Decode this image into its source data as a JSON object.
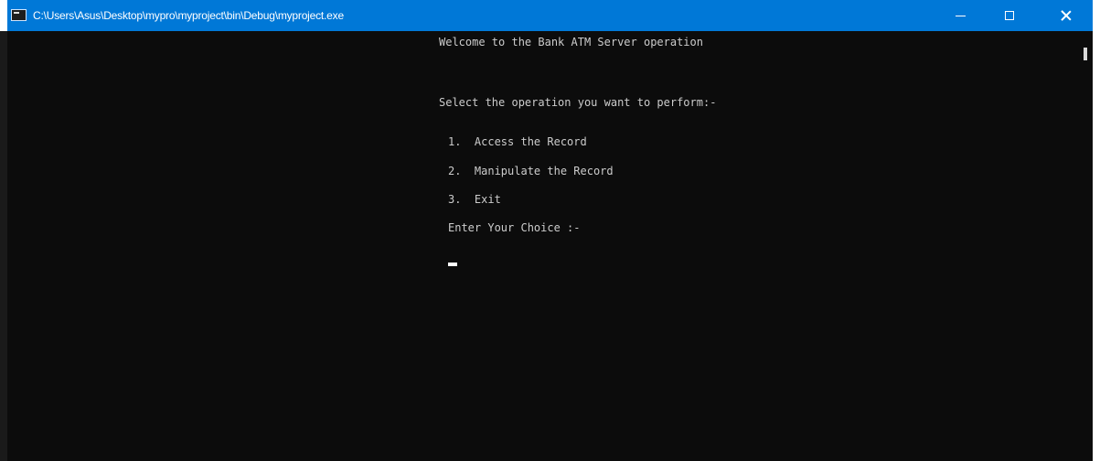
{
  "window": {
    "title": "C:\\Users\\Asus\\Desktop\\mypro\\myproject\\bin\\Debug\\myproject.exe",
    "icon": "console-app-icon",
    "controls": {
      "minimize_icon": "minimize-icon",
      "maximize_icon": "maximize-icon",
      "close_icon": "close-icon"
    },
    "colors": {
      "titlebar": "#0078d7",
      "console_bg": "#0c0c0c",
      "console_text": "#cccccc"
    }
  },
  "console": {
    "welcome": "Welcome to the Bank ATM Server operation",
    "prompt": "Select the operation you want to perform:-",
    "options": [
      "1.  Access the Record",
      "2.  Manipulate the Record",
      "3.  Exit"
    ],
    "choice_prompt": "Enter Your Choice :-"
  }
}
